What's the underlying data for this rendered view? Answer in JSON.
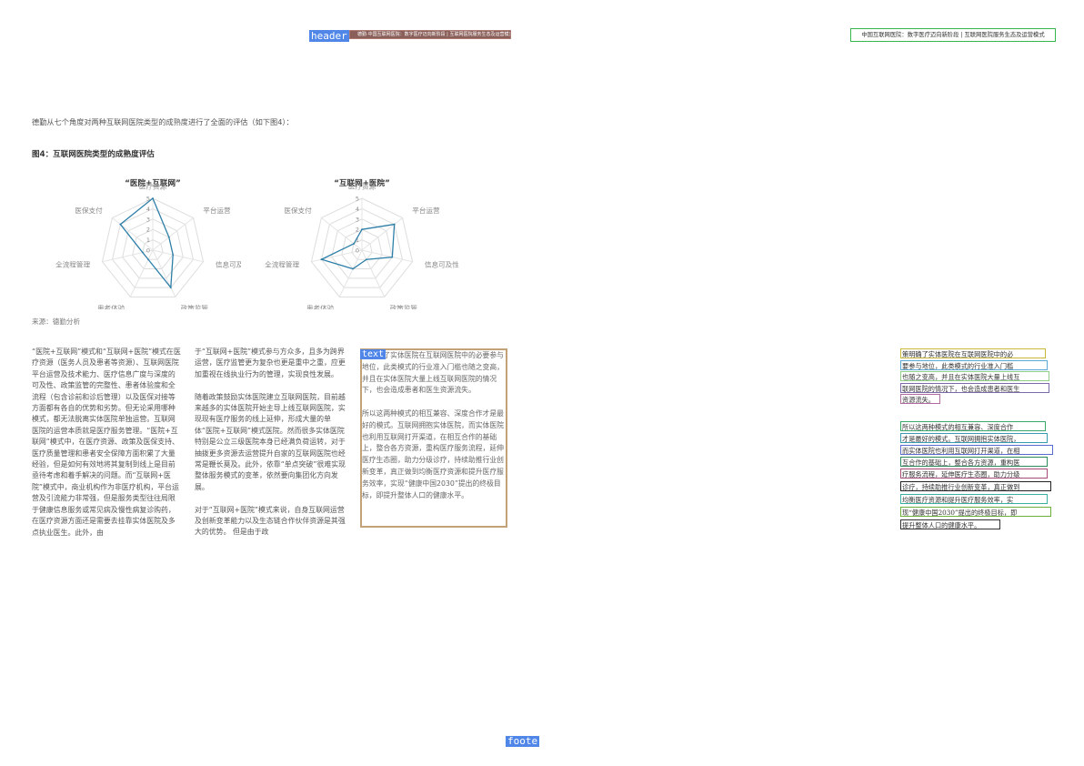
{
  "header": {
    "tag": "header",
    "center_text": "德勤·中国互联网医院：数字医疗迈向新阶段 | 互联网医院服务生态及运营模式",
    "right_text": "中国互联网医院：数字医疗迈向新阶段 | 互联网医院服务生态及运营模式"
  },
  "intro": "德勤从七个角度对两种互联网医院类型的成熟度进行了全面的评估（如下图4）：",
  "figure": {
    "title": "图4：互联网医院类型的成熟度评估",
    "source": "来源：德勤分析"
  },
  "chart_data": [
    {
      "type": "radar",
      "title": "“医院+互联网”",
      "axes": [
        "医疗资源",
        "平台运营",
        "信息可及性",
        "政策监管",
        "患者体验",
        "全流程管理",
        "医保支付"
      ],
      "tick_labels": [
        "0",
        "1",
        "2",
        "3",
        "4",
        "5"
      ],
      "range": [
        0,
        5
      ],
      "values": [
        5,
        2,
        2,
        4,
        1,
        1,
        4
      ],
      "color": "#2e7fa8"
    },
    {
      "type": "radar",
      "title": "“互联网+医院”",
      "axes": [
        "医疗资源",
        "平台运营",
        "信息可及性",
        "政策监管",
        "患者体验",
        "全流程管理",
        "医保支付"
      ],
      "tick_labels": [
        "0",
        "1",
        "2",
        "3",
        "4",
        "5"
      ],
      "range": [
        0,
        5
      ],
      "values": [
        2,
        4,
        3,
        1,
        2,
        4,
        1
      ],
      "color": "#2e7fa8"
    }
  ],
  "body": {
    "col1": "“医院+互联网”模式和“互联网+医院”模式在医疗资源（医务人员及患者等资源）、互联网医院平台运营及技术能力、医疗信息广度与深度的可及性、政策监管的完整性、患者体验度和全流程（包含诊前和诊后管理）以及医保对接等方面都有各自的优势和劣势。但无论采用哪种模式，都无法脱离实体医院单独运营。互联网医院的运营本质就是医疗服务管理。“医院+互联网”模式中，在医疗资源、政策及医保支持、医疗质量管理和患者安全保障方面积累了大量经验，但是如何有效地将其复制到线上是目前亟待考虑和着手解决的问题。而“互联网+医院”模式中，商业机构作为非医疗机构，平台运营及引流能力非常强，但是服务类型往往局限于健康信息服务或常见病及慢性病复诊购药，在医疗资源方面还是需要去挂靠实体医院及多点执业医生。此外，由",
    "col2_p1": "于“互联网+医院”模式参与方众多，且多为跨界运营，医疗监管更为复杂也更是重中之重，应更加重视在线执业行为的管理，实现良性发展。",
    "col2_p2": "随着政策鼓励实体医院建立互联网医院，目前越来越多的实体医院开始主导上线互联网医院，实现现有医疗服务的线上延伸，形成大量的单体“医院+互联网”模式医院。然而很多实体医院特别是公立三级医院本身已经满负荷运转，对于抽拨更多资源去运营提升自家的互联网医院也经常是鞭长莫及。此外，依靠“单点突破”很难实现整体服务模式的变革，依然要向集团化方向发展。",
    "col2_p3": "对于“互联网+医院”模式来说，自身互联网运营及创新变革能力以及生态链合作伙伴资源是其强大的优势。 但是由于政",
    "col3_tag": "text",
    "col3_p1": "说明确了实体医院在互联网医院中的必要参与地位，此类模式的行业准入门槛也随之变高，并且在实体医院大量上线互联网医院的情况下，也会造成患者和医生资源流失。",
    "col3_p2": "所以这两种模式的相互兼容、深度合作才是最好的模式。互联网拥抱实体医院，而实体医院也利用互联网打开渠道，在相互合作的基础上，整合各方资源，重构医疗服务流程，延伸医疗生态圈，助力分级诊疗，持续助推行业创新变革，真正做到均衡医疗资源和提升医疗服务效率，实现“健康中国2030”提出的终极目标，即提升整体人口的健康水平。"
  },
  "right_lines": [
    {
      "text": "策明确了实体医院在互联网医院中的必",
      "color": "#c9b93a"
    },
    {
      "text": "要参与地位，此类模式的行业准入门槛",
      "color": "#5aa8d6"
    },
    {
      "text": "也随之变高，并且在实体医院大量上线互",
      "color": "#8fcf8a"
    },
    {
      "text": "联网医院的情况下，也会造成患者和医生",
      "color": "#7a6aa8"
    },
    {
      "text": "资源流失。",
      "color": "#b06aa0"
    },
    {
      "text": "所以这两种模式的相互兼容、深度合作",
      "color": "#3aa86a"
    },
    {
      "text": "才是最好的模式。互联网拥抱实体医院，",
      "color": "#3a9ab0"
    },
    {
      "text": "而实体医院也利用互联网打开渠道，在相",
      "color": "#5a6ad0"
    },
    {
      "text": "互合作的基础上，整合各方资源，重构医",
      "color": "#2a8a5a"
    },
    {
      "text": "疗服务流程，延伸医疗生态圈，助力分级",
      "color": "#a84a7a"
    },
    {
      "text": "诊疗，持续助推行业创新变革，真正做到",
      "color": "#222222"
    },
    {
      "text": "均衡医疗资源和提升医疗服务效率，实",
      "color": "#3ab0a0"
    },
    {
      "text": "现“健康中国2030”提出的终极目标，即",
      "color": "#6ab03a"
    },
    {
      "text": "提升整体人口的健康水平。",
      "color": "#333333"
    }
  ],
  "footer": {
    "tag": "foote"
  }
}
